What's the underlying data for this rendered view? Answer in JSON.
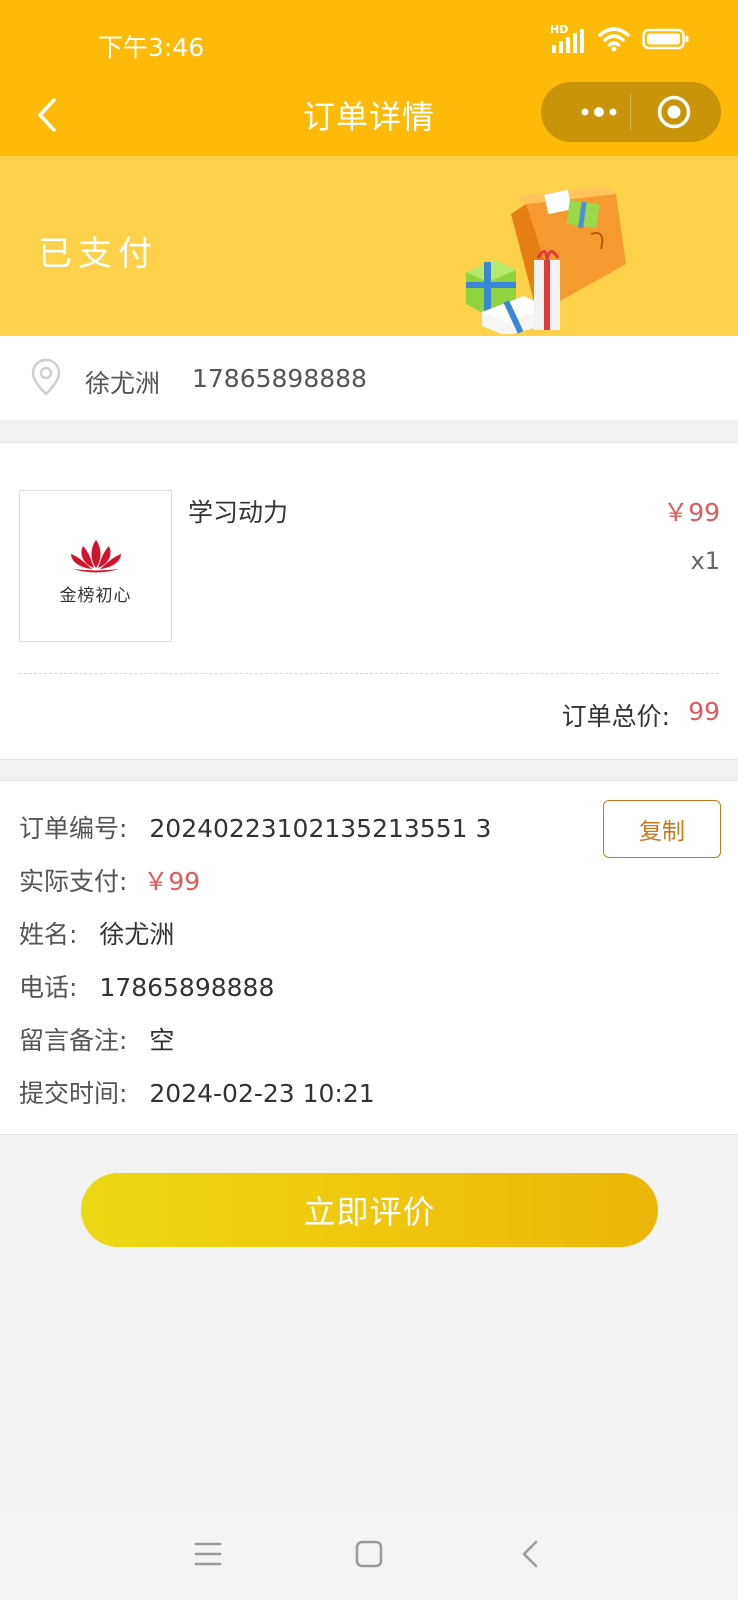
{
  "status_bar": {
    "time": "下午3:46",
    "network": "HD"
  },
  "nav": {
    "title": "订单详情"
  },
  "banner": {
    "status": "已支付"
  },
  "address": {
    "name": "徐尤洲",
    "phone": "17865898888"
  },
  "product": {
    "thumb_text": "金榜初心",
    "name": "学习动力",
    "price": "￥99",
    "quantity": "x1",
    "total_label": "订单总价:",
    "total_value": "99"
  },
  "details": {
    "order_no_label": "订单编号:",
    "order_no": "20240223102135213551 3",
    "paid_label": "实际支付:",
    "paid": "￥99",
    "name_label": "姓名:",
    "name": "徐尤洲",
    "phone_label": "电话:",
    "phone": "17865898888",
    "remark_label": "留言备注:",
    "remark": "空",
    "time_label": "提交时间:",
    "time": "2024-02-23 10:21",
    "copy_label": "复制"
  },
  "actions": {
    "review_label": "立即评价"
  },
  "colors": {
    "header": "#fdba08",
    "banner": "#fdd14a",
    "price": "#e05a5a",
    "copy_border": "#c77a1f"
  }
}
